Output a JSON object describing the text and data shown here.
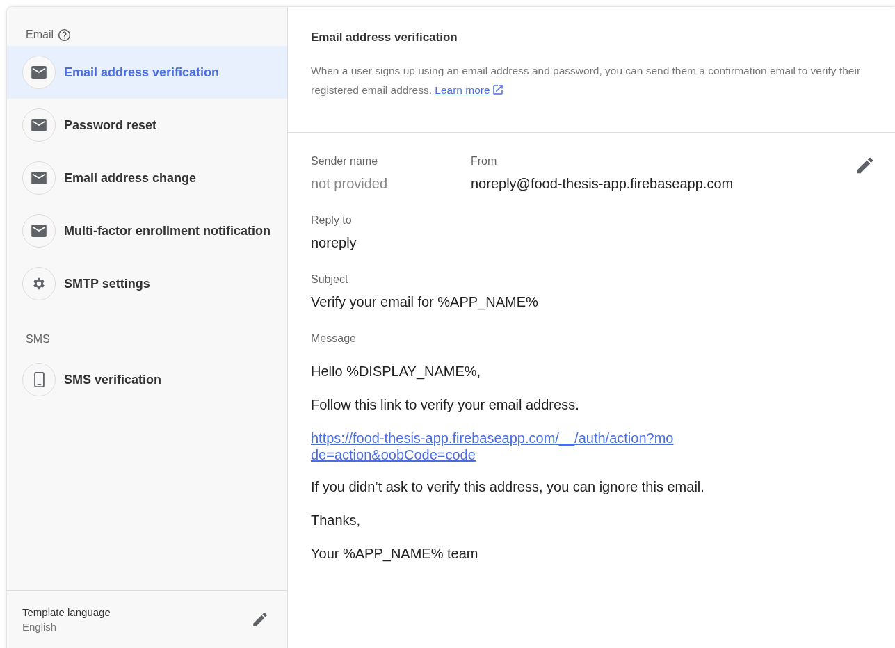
{
  "sidebar": {
    "sections": [
      {
        "title": "Email",
        "help": true,
        "items": [
          {
            "label": "Email address verification",
            "kind": "mail",
            "selected": true
          },
          {
            "label": "Password reset",
            "kind": "mail",
            "selected": false
          },
          {
            "label": "Email address change",
            "kind": "mail",
            "selected": false
          },
          {
            "label": "Multi-factor enrollment notification",
            "kind": "mail",
            "selected": false
          },
          {
            "label": "SMTP settings",
            "kind": "gear",
            "selected": false
          }
        ]
      },
      {
        "title": "SMS",
        "help": false,
        "items": [
          {
            "label": "SMS verification",
            "kind": "phone",
            "selected": false
          }
        ]
      }
    ],
    "footer": {
      "label": "Template language",
      "value": "English"
    }
  },
  "detail": {
    "title": "Email address verification",
    "description": "When a user signs up using an email address and password, you can send them a confirmation email to verify their registered email address.",
    "learn_more": "Learn more",
    "sender": {
      "label": "Sender name",
      "value": "not provided",
      "provided": false
    },
    "from": {
      "label": "From",
      "value": "noreply@food-thesis-app.firebaseapp.com"
    },
    "reply_to": {
      "label": "Reply to",
      "value": "noreply"
    },
    "subject": {
      "label": "Subject",
      "value": "Verify your email for %APP_NAME%"
    },
    "message": {
      "label": "Message",
      "paragraphs": [
        {
          "kind": "text",
          "text": "Hello %DISPLAY_NAME%,"
        },
        {
          "kind": "text",
          "text": "Follow this link to verify your email address."
        },
        {
          "kind": "link",
          "text": "https://food-thesis-app.firebaseapp.com/__/auth/action?mode=action&oobCode=code"
        },
        {
          "kind": "text",
          "text": "If you didn’t ask to verify this address, you can ignore this email."
        },
        {
          "kind": "text",
          "text": "Thanks,"
        },
        {
          "kind": "text",
          "text": "Your %APP_NAME% team"
        }
      ]
    }
  }
}
